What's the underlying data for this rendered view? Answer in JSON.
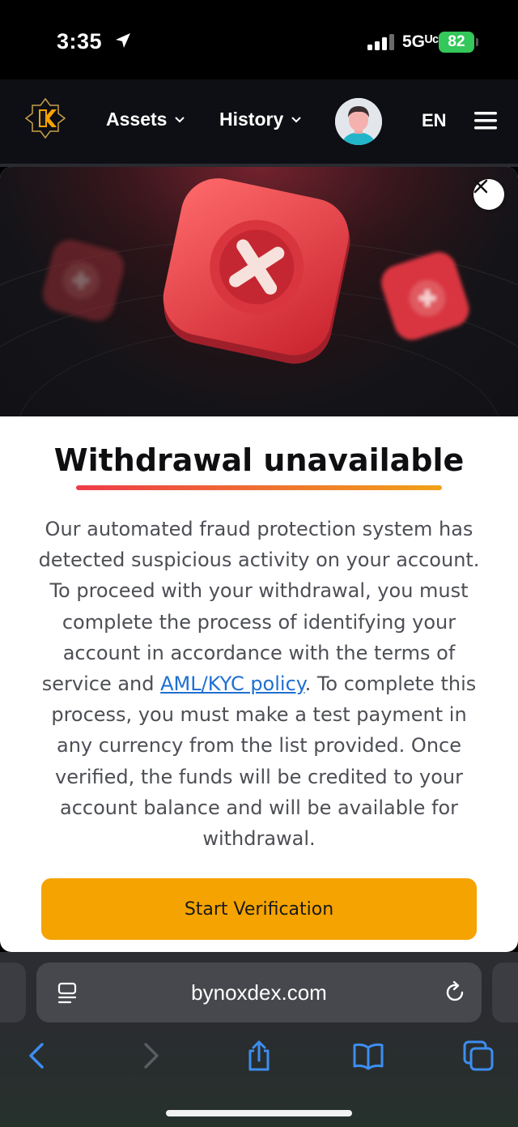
{
  "status_bar": {
    "time": "3:35",
    "network": "5Gᵁᶜ",
    "battery": "82"
  },
  "nav": {
    "assets_label": "Assets",
    "history_label": "History",
    "language": "EN"
  },
  "modal": {
    "title": "Withdrawal unavailable",
    "body_before_link": "Our automated fraud protection system has detected suspicious activity on your account. To proceed with your withdrawal, you must complete the process of identifying your account in accordance with the terms of service and ",
    "link_text": "AML/KYC policy",
    "body_after_link": ". To complete this process, you must make a test payment in any currency from the list provided. Once verified, the funds will be credited to your account balance and will be available for withdrawal.",
    "cta_label": "Start Verification"
  },
  "browser": {
    "url": "bynoxdex.com"
  },
  "colors": {
    "accent": "#f5a300",
    "link": "#1f6fd1",
    "underline_start": "#ee3b4a",
    "underline_end": "#f0a21a",
    "battery": "#34c759"
  }
}
